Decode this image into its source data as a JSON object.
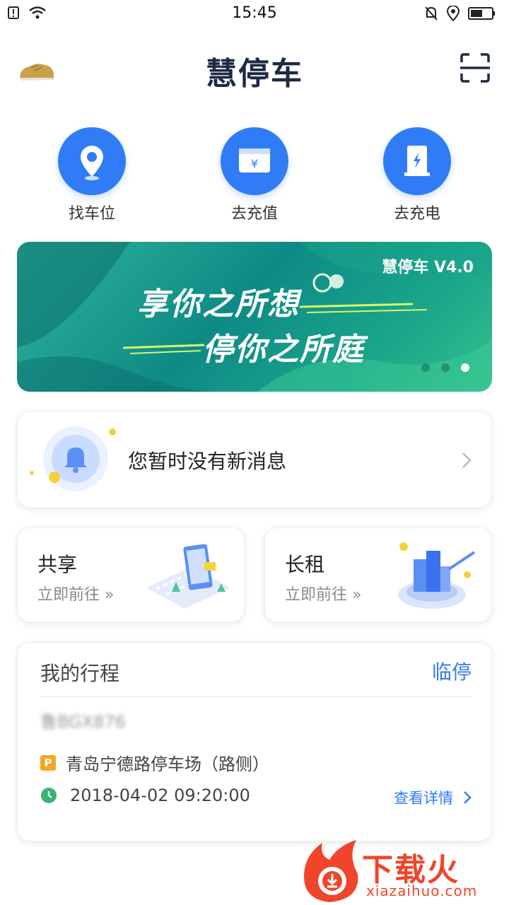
{
  "status_bar": {
    "time": "15:45"
  },
  "header": {
    "title": "慧停车"
  },
  "quick_actions": [
    {
      "label": "找车位",
      "icon": "location-pin-icon"
    },
    {
      "label": "去充值",
      "icon": "wallet-icon"
    },
    {
      "label": "去充电",
      "icon": "charging-station-icon"
    }
  ],
  "banner": {
    "brand": "慧停车 V4.0",
    "line1": "享你之所想",
    "line2": "停你之所庭",
    "active_dot": 3
  },
  "message": {
    "text": "您暂时没有新消息"
  },
  "services": [
    {
      "title": "共享",
      "sub": "立即前往 »"
    },
    {
      "title": "长租",
      "sub": "立即前往 »"
    }
  ],
  "trip": {
    "title": "我的行程",
    "tag": "临停",
    "plate": "鲁BGX876",
    "location": "青岛宁德路停车场（路侧）",
    "p_badge": "P",
    "time": "2018-04-02 09:20:00",
    "detail_link": "查看详情"
  },
  "watermark": {
    "name": "下载火",
    "url": "xiazaihuo.com"
  },
  "colors": {
    "accent": "#2f7cf6",
    "banner_green": "#0e8a86",
    "parking_orange": "#f5a623",
    "clock_green": "#3cb371"
  }
}
